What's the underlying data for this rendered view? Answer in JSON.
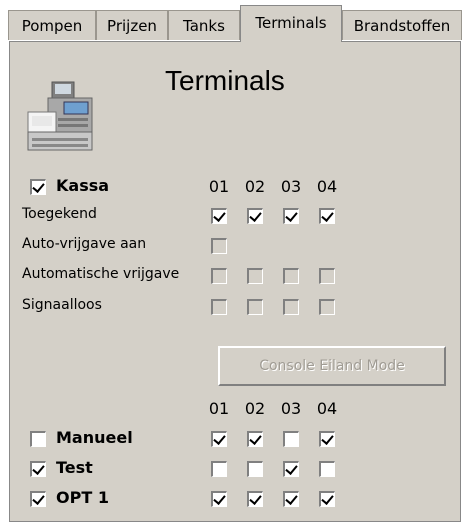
{
  "tabs": [
    "Pompen",
    "Prijzen",
    "Tanks",
    "Terminals",
    "Brandstoffen"
  ],
  "active_tab": "Terminals",
  "title": "Terminals",
  "icon": "cash-register-icon",
  "columns": [
    "01",
    "02",
    "03",
    "04"
  ],
  "kassa": {
    "label": "Kassa",
    "checked": true
  },
  "rows": [
    {
      "label": "Toegekend",
      "checks": [
        true,
        true,
        true,
        true
      ],
      "disabled": [
        false,
        false,
        false,
        false
      ]
    },
    {
      "label": "Auto-vrijgave aan",
      "checks": [
        false
      ],
      "disabled": [
        true
      ]
    },
    {
      "label": "Automatische vrijgave",
      "checks": [
        false,
        false,
        false,
        false
      ],
      "disabled": [
        true,
        true,
        true,
        true
      ]
    },
    {
      "label": "Signaalloos",
      "checks": [
        false,
        false,
        false,
        false
      ],
      "disabled": [
        true,
        true,
        true,
        true
      ]
    }
  ],
  "button_label": "Console Eiland Mode",
  "terminals": [
    {
      "label": "Manueel",
      "enabled": false,
      "checks": [
        true,
        true,
        false,
        true
      ]
    },
    {
      "label": "Test",
      "enabled": true,
      "checks": [
        false,
        false,
        true,
        false
      ]
    },
    {
      "label": "OPT 1",
      "enabled": true,
      "checks": [
        true,
        true,
        true,
        true
      ]
    }
  ]
}
